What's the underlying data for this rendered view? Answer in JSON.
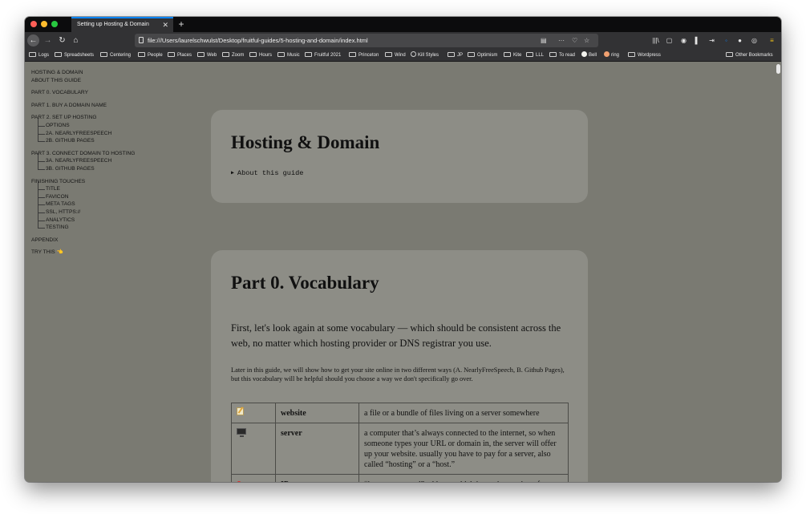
{
  "browser": {
    "tab_title": "Setting up Hosting & Domain",
    "tab_close": "✕",
    "new_tab": "+",
    "url": "file:///Users/laurelschwulst/Desktop/fruitful-guides/5-hosting-and-domain/index.html",
    "nav": {
      "back": "←",
      "forward": "→",
      "reload": "↻",
      "home": "⌂"
    },
    "url_actions": [
      "▤",
      "···",
      "♡",
      "☆"
    ],
    "toolbar_icons": [
      "library-icon",
      "sidebar-icon",
      "account-icon",
      "shield-icon",
      "extension-icon",
      "extension-icon",
      "extension-icon",
      "extension-icon",
      "menu-icon"
    ],
    "toolbar_glyphs": [
      "|||\\",
      "▢",
      "◉",
      "▌",
      "⇥",
      "◦",
      "●",
      "◎",
      "≡"
    ],
    "accent_color": "#0a84ff"
  },
  "bookmarks": [
    {
      "label": "Logs",
      "icon": "folder"
    },
    {
      "label": "Spreadsheets",
      "icon": "folder"
    },
    {
      "label": "Centering",
      "icon": "folder"
    },
    {
      "label": "People",
      "icon": "folder"
    },
    {
      "label": "Places",
      "icon": "folder"
    },
    {
      "label": "Web",
      "icon": "folder"
    },
    {
      "label": "Zoom",
      "icon": "folder"
    },
    {
      "label": "Hours",
      "icon": "folder"
    },
    {
      "label": "Music",
      "icon": "folder"
    },
    {
      "label": "Fruitful 2021",
      "icon": "folder"
    },
    {
      "label": "Princeton",
      "icon": "folder"
    },
    {
      "label": "Wind",
      "icon": "folder"
    },
    {
      "label": "Kill Styles",
      "icon": "globe"
    },
    {
      "label": "JP",
      "icon": "folder"
    },
    {
      "label": "Optimism",
      "icon": "folder"
    },
    {
      "label": "Kite",
      "icon": "folder"
    },
    {
      "label": "LLL",
      "icon": "folder"
    },
    {
      "label": "To read",
      "icon": "folder"
    },
    {
      "label": "Bell",
      "icon": "circle-white"
    },
    {
      "label": "ring",
      "icon": "circle-orange"
    },
    {
      "label": "Wordpress",
      "icon": "folder"
    }
  ],
  "other_bookmarks": "Other Bookmarks",
  "toc": [
    {
      "label": "HOSTING & DOMAIN",
      "level": 0,
      "gap": false
    },
    {
      "label": "ABOUT THIS GUIDE",
      "level": 0,
      "gap": false
    },
    {
      "label": "PART 0. VOCABULARY",
      "level": 0,
      "gap": true
    },
    {
      "label": "PART 1. BUY A DOMAIN NAME",
      "level": 0,
      "gap": true
    },
    {
      "label": "PART 2. SET UP HOSTING",
      "level": 0,
      "gap": true
    },
    {
      "label": "OPTIONS",
      "level": 1,
      "gap": false
    },
    {
      "label": "2A. NEARLYFREESPEECH",
      "level": 1,
      "gap": false
    },
    {
      "label": "2B. GITHUB PAGES",
      "level": 1,
      "gap": false
    },
    {
      "label": "PART 3. CONNECT DOMAIN TO HOSTING",
      "level": 0,
      "gap": true
    },
    {
      "label": "3A. NEARLYFREESPEECH",
      "level": 1,
      "gap": false
    },
    {
      "label": "3B. GITHUB PAGES",
      "level": 1,
      "gap": false
    },
    {
      "label": "FINISHING TOUCHES",
      "level": 0,
      "gap": true
    },
    {
      "label": "TITLE",
      "level": 1,
      "gap": false
    },
    {
      "label": "FAVICON",
      "level": 1,
      "gap": false
    },
    {
      "label": "META TAGS",
      "level": 1,
      "gap": false
    },
    {
      "label": "SSL, HTTPS://",
      "level": 1,
      "gap": false
    },
    {
      "label": "ANALYTICS",
      "level": 1,
      "gap": false
    },
    {
      "label": "TESTING",
      "level": 1,
      "gap": false
    },
    {
      "label": "APPENDIX",
      "level": 0,
      "gap": true
    },
    {
      "label": "TRY THIS 👈",
      "level": 0,
      "gap": true
    }
  ],
  "header_card": {
    "title": "Hosting & Domain",
    "details_marker": "▶",
    "details_summary": "About this guide"
  },
  "vocab_card": {
    "title": "Part 0. Vocabulary",
    "lead": "First, let's look again at some vocabulary — which should be consistent across the web, no matter which hosting provider or DNS registrar you use.",
    "note": "Later in this guide, we will show how to get your site online in two different ways (A. NearlyFreeSpeech, B. Github Pages), but this vocabulary will be helpful should you choose a way we don't specifically go over.",
    "rows": [
      {
        "icon": "memo-icon",
        "term": "website",
        "definition": "a file or a bundle of files living on a server somewhere"
      },
      {
        "icon": "computer-icon",
        "term": "server",
        "definition": "a computer that’s always connected to the internet, so when someone types your URL or domain in, the server will offer up your website. usually you have to pay for a server, also called “hosting” or a “host.”"
      },
      {
        "icon": "pushpin-icon",
        "term": "IP",
        "definition": "“internet protocol” address, which is a unique string of numbers that’s an address for any device connected to"
      }
    ]
  },
  "colors": {
    "page_bg": "#7a7a72",
    "card_bg": "#8d8d86",
    "chrome_dark": "#323234",
    "tabbar": "#0c0c0d"
  }
}
